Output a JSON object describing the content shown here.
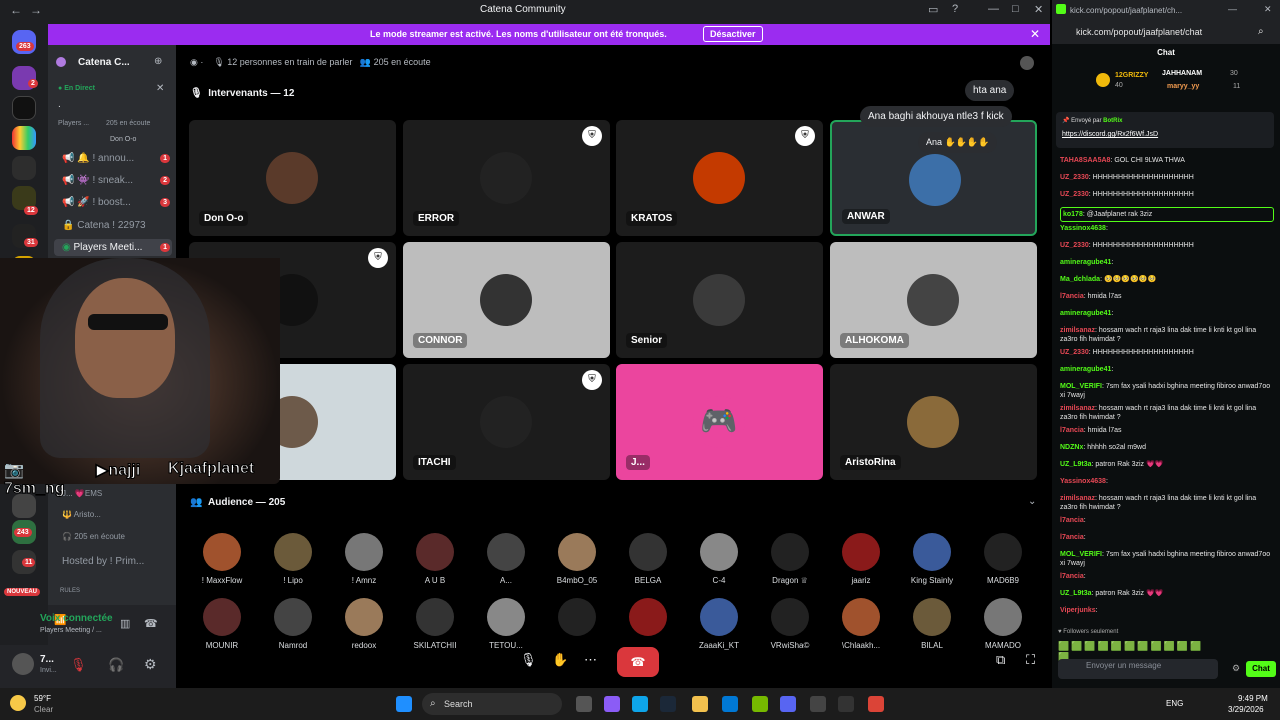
{
  "discord": {
    "window_title": "Catena Community",
    "banner_text": "Le mode streamer est activé. Les noms d'utilisateur ont été tronqués.",
    "banner_button": "Désactiver",
    "server_name": "Catena C...",
    "live_label": "En Direct",
    "dot": ".",
    "players_label": "Players ...",
    "players_listen": "205 en écoute",
    "don_label": "Don O-o",
    "channels": [
      {
        "label": "! annou...",
        "badge": "1"
      },
      {
        "label": "! sneak...",
        "badge": "2"
      },
      {
        "label": "! boost...",
        "badge": "3"
      },
      {
        "label": "Catena ! 22973",
        "badge": ""
      },
      {
        "label": "Players Meeti...",
        "badge": "1"
      }
    ],
    "voice_members": [
      "J...",
      "EMS",
      "Aristo..."
    ],
    "listen_count": "205 en écoute",
    "hosted_by": "Hosted by ! Prim...",
    "rules_label": "RULES",
    "nouveau": "NOUVEAU",
    "voice_connected": "Voix connectée",
    "voice_channel": "Players Meeting / ...",
    "user_short": "7...",
    "user_sub": "Invi...",
    "stage_header": {
      "speaking": "12 personnes en train de parler",
      "listening": "205 en écoute"
    },
    "speakers_title": "Intervenants — 12",
    "audience_title": "Audience — 205",
    "guild_badges": [
      "263",
      "2",
      "12",
      "31",
      "1",
      "37",
      "243",
      "11"
    ],
    "speakers": [
      {
        "name": "Don O-o",
        "bg": "#1c1c1c",
        "av": "#5a3a2a"
      },
      {
        "name": "ERROR",
        "bg": "#1c1c1c",
        "av": "#222"
      },
      {
        "name": "KRATOS",
        "bg": "#1c1c1c",
        "av": "#c43a00"
      },
      {
        "name": "ANWAR",
        "bg": "#2a2e33",
        "av": "#3c6fa8"
      },
      {
        "name": "I...",
        "bg": "#1c1c1c",
        "av": "#111"
      },
      {
        "name": "CONNOR",
        "bg": "#bdbdbd",
        "av": "#333"
      },
      {
        "name": "Senior",
        "bg": "#1c1c1c",
        "av": "#3a3a3a"
      },
      {
        "name": "ALHOKOMA",
        "bg": "#bdbdbd",
        "av": "#444"
      },
      {
        "name": "",
        "bg": "#cfd8dc",
        "av": "#6d5a4a"
      },
      {
        "name": "ITACHI",
        "bg": "#1c1c1c",
        "av": "#222"
      },
      {
        "name": "J...",
        "bg": "#eb459e",
        "av": "#eb459e"
      },
      {
        "name": "AristoRina",
        "bg": "#1c1c1c",
        "av": "#8a6a3a"
      }
    ],
    "bubbles": [
      "hta ana",
      "Ana baghi akhouya ntle3 f kick",
      "Ana ✋✋✋✋"
    ],
    "audience_row1": [
      "! MaxxFlow",
      "! Lipo",
      "! Amnz",
      "A U B",
      "A...",
      "B4mbO_05",
      "BELGA",
      "C-4",
      "Dragon ♕",
      "jaariz",
      "King Stainly",
      "MAD6B9"
    ],
    "audience_row2": [
      "MOUNIR",
      "Namrod",
      "redoox",
      "SKILATCHII",
      "TETOU...",
      "",
      "",
      "ZaaaKi_KT",
      "VRwiSha©",
      "\\Chlaakh...",
      "BILAL",
      "MAMADO"
    ],
    "socials": [
      "7sm_ng",
      "najji",
      "jaafplanet"
    ]
  },
  "kick": {
    "url": "kick.com/popout/jaafplanet/chat",
    "url_short": "kick.com/popout/jaafplanet/ch...",
    "chat_title": "Chat",
    "top": [
      {
        "name": "12GRIZZY",
        "val": "40"
      },
      {
        "name": "JAHHANAM",
        "val": "30"
      },
      {
        "name": "maryy_yy",
        "val": "11"
      }
    ],
    "pinned_by": "Envoyé par",
    "pinned_bot": "BotRix",
    "pinned_link": "https://discord.gg/Rx2f6Wf.JsD",
    "messages": [
      {
        "u": "TAHA8SAA5A8",
        "c": "#e84855",
        "t": ": GOL CHI 9LWA THWA"
      },
      {
        "u": "UZ_2330",
        "c": "#e84855",
        "t": ": HHHHHHHHHHHHHHHHHHHH"
      },
      {
        "u": "UZ_2330",
        "c": "#e84855",
        "t": ": HHHHHHHHHHHHHHHHHHHH"
      },
      {
        "u": "ko178",
        "c": "#53fc18",
        "t": ": @Jaafplanet rak 3ziz"
      },
      {
        "u": "Yassinox4638",
        "c": "#53fc18",
        "t": ":"
      },
      {
        "u": "UZ_2330",
        "c": "#e84855",
        "t": ": HHHHHHHHHHHHHHHHHHHH"
      },
      {
        "u": "amineragube41",
        "c": "#53fc18",
        "t": ":"
      },
      {
        "u": "Ma_dchlada",
        "c": "#53fc18",
        "t": ": 🥺🥺🥺🥺🥺🥺"
      },
      {
        "u": "l7ancia",
        "c": "#e84855",
        "t": ": hmida l7as"
      },
      {
        "u": "amineragube41",
        "c": "#53fc18",
        "t": ":"
      },
      {
        "u": "zimilsanaz",
        "c": "#e84855",
        "t": ": hossam wach rt raja3 lina dak time li knti kt gol lina za3ro fih hwimdat ?"
      },
      {
        "u": "UZ_2330",
        "c": "#e84855",
        "t": ": HHHHHHHHHHHHHHHHHHHH"
      },
      {
        "u": "amineragube41",
        "c": "#53fc18",
        "t": ":"
      },
      {
        "u": "MOL_VERIFI",
        "c": "#53fc18",
        "t": ": 7sm fax ysali hadxi bghina meeting fibiroo anwad7oo xi 7wayj"
      },
      {
        "u": "zimilsanaz",
        "c": "#e84855",
        "t": ": hossam wach rt raja3 lina dak time li knti kt gol lina za3ro fih hwimdat ?"
      },
      {
        "u": "l7ancia",
        "c": "#e84855",
        "t": ": hmida l7as"
      },
      {
        "u": "NDZNx",
        "c": "#53fc18",
        "t": ": hhhhh so2al m9wd"
      },
      {
        "u": "UZ_L9t3a",
        "c": "#53fc18",
        "t": ": patron Rak 3ziz 💗💗"
      },
      {
        "u": "Yassinox4638",
        "c": "#e84855",
        "t": ":"
      },
      {
        "u": "zimilsanaz",
        "c": "#e84855",
        "t": ": hossam wach rt raja3 lina dak time li knti kt gol lina za3ro fih hwimdat ?"
      },
      {
        "u": "l7ancia",
        "c": "#e84855",
        "t": ":"
      },
      {
        "u": "l7ancia",
        "c": "#e84855",
        "t": ":"
      },
      {
        "u": "MOL_VERIFI",
        "c": "#53fc18",
        "t": ": 7sm fax ysali hadxi bghina meeting fibiroo anwad7oo xi 7wayj"
      },
      {
        "u": "l7ancia",
        "c": "#e84855",
        "t": ":"
      },
      {
        "u": "UZ_L9t3a",
        "c": "#53fc18",
        "t": ": patron Rak 3ziz 💗💗"
      },
      {
        "u": "Viperjunks",
        "c": "#e84855",
        "t": ":"
      }
    ],
    "followers_only": "Followers seulement",
    "input_placeholder": "Envoyer un message",
    "chat_button": "Chat"
  },
  "taskbar": {
    "temp": "59°F",
    "weather": "Clear",
    "search": "Search",
    "lang": "ENG",
    "time": "9:49 PM",
    "date": "3/29/2026"
  }
}
